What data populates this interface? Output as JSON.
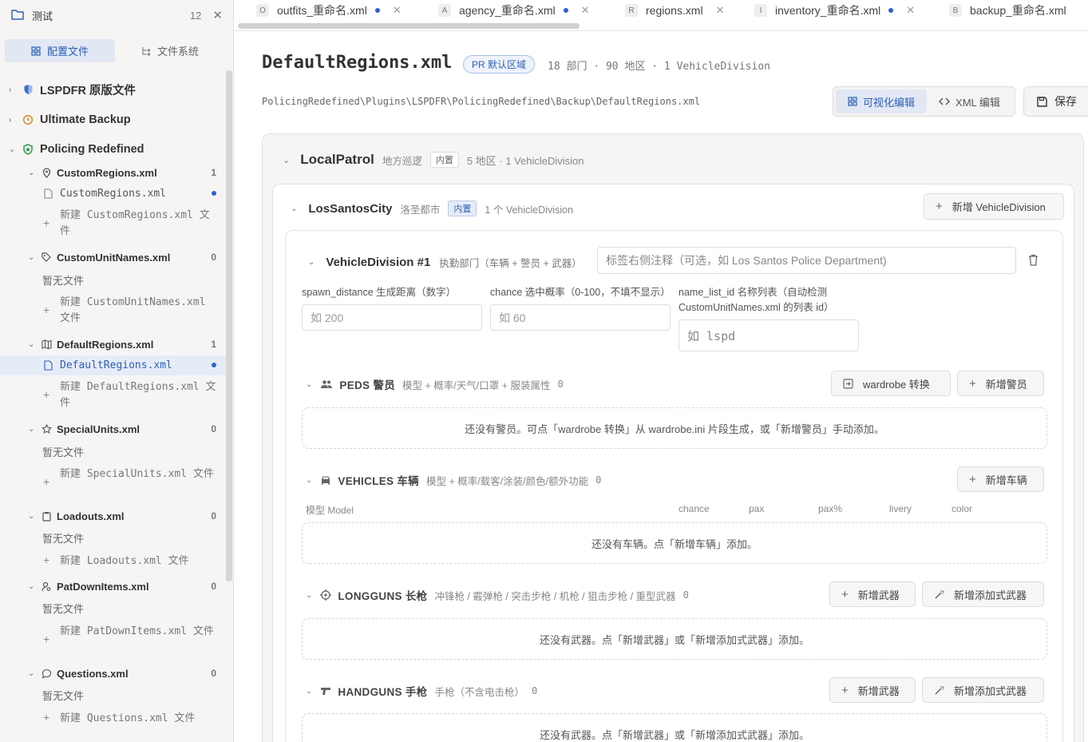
{
  "sidebar": {
    "title": "测试",
    "count": "12",
    "tabs": [
      "配置文件",
      "文件系统"
    ],
    "groups": [
      {
        "label": "LSPDFR 原版文件"
      },
      {
        "label": "Ultimate Backup"
      },
      {
        "label": "Policing Redefined"
      }
    ],
    "files": [
      {
        "name": "CustomRegions.xml",
        "count": "1",
        "child": "CustomRegions.xml",
        "new": "新建 CustomRegions.xml 文件"
      },
      {
        "name": "CustomUnitNames.xml",
        "count": "0",
        "child": "暂无文件",
        "new": "新建 CustomUnitNames.xml 文件"
      },
      {
        "name": "DefaultRegions.xml",
        "count": "1",
        "child": "DefaultRegions.xml",
        "new": "新建 DefaultRegions.xml 文件"
      },
      {
        "name": "SpecialUnits.xml",
        "count": "0",
        "child": "暂无文件",
        "new": "新建 SpecialUnits.xml 文件"
      },
      {
        "name": "Loadouts.xml",
        "count": "0",
        "child": "暂无文件",
        "new": "新建 Loadouts.xml 文件"
      },
      {
        "name": "PatDownItems.xml",
        "count": "0",
        "child": "暂无文件",
        "new": "新建 PatDownItems.xml 文件"
      },
      {
        "name": "Questions.xml",
        "count": "0",
        "child": "暂无文件",
        "new": "新建 Questions.xml 文件"
      }
    ]
  },
  "tabs": [
    {
      "letter": "O",
      "name": "outfits_重命名.xml",
      "dirty": true
    },
    {
      "letter": "A",
      "name": "agency_重命名.xml",
      "dirty": true
    },
    {
      "letter": "R",
      "name": "regions.xml",
      "dirty": false
    },
    {
      "letter": "I",
      "name": "inventory_重命名.xml",
      "dirty": true
    },
    {
      "letter": "B",
      "name": "backup_重命名.xml",
      "dirty": false
    }
  ],
  "main": {
    "title": "DefaultRegions.xml",
    "badge": "PR 默认区域",
    "stats": "18 部门 · 90 地区 · 1 VehicleDivision",
    "path": "PolicingRedefined\\Plugins\\LSPDFR\\PolicingRedefined\\Backup\\DefaultRegions.xml",
    "mode_visual": "可视化编辑",
    "mode_xml": "XML 编辑",
    "save": "保存",
    "region": {
      "name": "LocalPatrol",
      "cn": "地方巡逻",
      "tag": "内置",
      "meta": "5 地区 · 1 VehicleDivision"
    },
    "area": {
      "name": "LosSantosCity",
      "cn": "洛圣都市",
      "tag": "内置",
      "meta": "1 个 VehicleDivision",
      "add_btn": "新增 VehicleDivision"
    },
    "division": {
      "name": "VehicleDivision #1",
      "desc": "执勤部门（车辆 + 警员 + 武器）",
      "note_placeholder": "标签右侧注释（可选，如 Los Santos Police Department)",
      "spawn_label": "spawn_distance 生成距离（数字）",
      "spawn_placeholder": "如 200",
      "chance_label": "chance 选中概率（0-100，不填不显示）",
      "chance_placeholder": "如 60",
      "namelist_label1": "name_list_id 名称列表（自动检测",
      "namelist_label2": "CustomUnitNames.xml 的列表 id）",
      "namelist_placeholder": "如 lspd"
    },
    "sections": {
      "peds": {
        "name": "PEDS 警员",
        "desc": "模型 + 概率/天气/口罩 + 服装属性",
        "count": "0",
        "btn1": "wardrobe 转换",
        "btn2": "新增警员",
        "empty": "还没有警员。可点「wardrobe 转换」从 wardrobe.ini 片段生成，或「新增警员」手动添加。"
      },
      "vehicles": {
        "name": "VEHICLES 车辆",
        "desc": "模型 + 概率/载客/涂装/颜色/额外功能",
        "count": "0",
        "btn": "新增车辆",
        "cols": [
          "模型 Model",
          "chance",
          "pax",
          "pax%",
          "livery",
          "color"
        ],
        "empty": "还没有车辆。点「新增车辆」添加。"
      },
      "longguns": {
        "name": "LONGGUNS 长枪",
        "desc": "冲锋枪 / 霰弹枪 / 突击步枪 / 机枪 / 狙击步枪 / 重型武器",
        "count": "0",
        "btn1": "新增武器",
        "btn2": "新增添加式武器",
        "empty": "还没有武器。点「新增武器」或「新增添加式武器」添加。"
      },
      "handguns": {
        "name": "HANDGUNS 手枪",
        "desc": "手枪（不含电击枪）",
        "count": "0",
        "btn1": "新增武器",
        "btn2": "新增添加式武器",
        "empty": "还没有武器。点「新增武器」或「新增添加式武器」添加。"
      }
    }
  },
  "colors": {
    "accent": "#2d5fb5",
    "dot": "#2e62d0"
  }
}
